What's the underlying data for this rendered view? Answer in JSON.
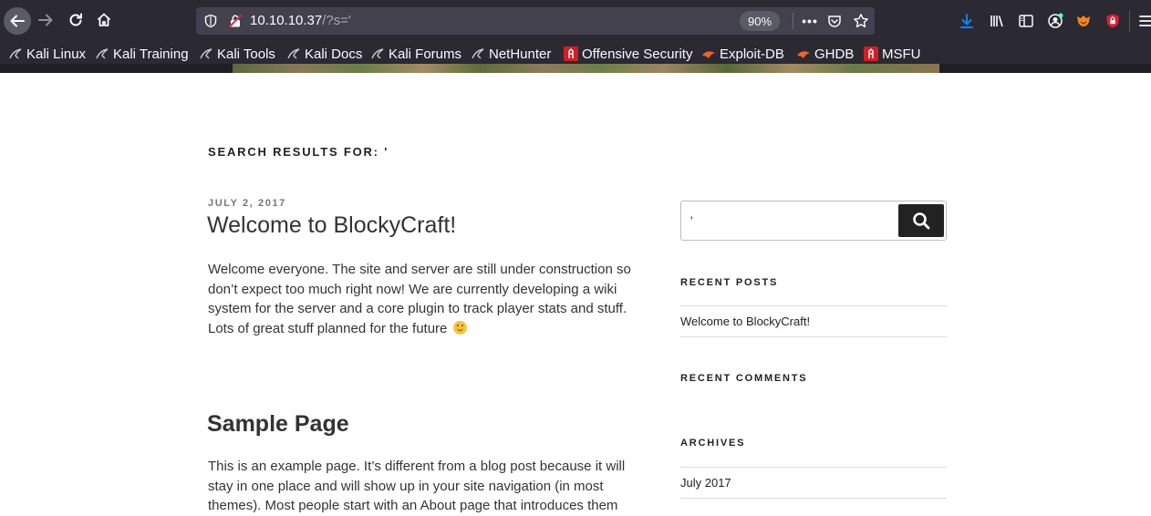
{
  "browser": {
    "url_host": "10.10.10.37",
    "url_path": "/?s='",
    "zoom": "90%",
    "bookmarks": [
      {
        "label": "Kali Linux",
        "icon": "kali-dragon-icon"
      },
      {
        "label": "Kali Training",
        "icon": "kali-dragon-icon"
      },
      {
        "label": "Kali Tools",
        "icon": "kali-dragon-icon"
      },
      {
        "label": "Kali Docs",
        "icon": "kali-dragon-icon"
      },
      {
        "label": "Kali Forums",
        "icon": "kali-dragon-icon"
      },
      {
        "label": "NetHunter",
        "icon": "kali-dragon-icon"
      },
      {
        "label": "Offensive Security",
        "icon": "offsec-icon"
      },
      {
        "label": "Exploit-DB",
        "icon": "exploitdb-icon"
      },
      {
        "label": "GHDB",
        "icon": "exploitdb-icon"
      },
      {
        "label": "MSFU",
        "icon": "offsec-icon"
      }
    ]
  },
  "content": {
    "search_heading": "Search Results for: '",
    "posts": [
      {
        "date": "July 2, 2017",
        "title": "Welcome to BlockyCraft!",
        "excerpt": "Welcome everyone. The site and server are still under construction so don’t expect too much right now! We are currently developing a wiki system for the server and a core plugin to track player stats and stuff. Lots of great stuff planned for the future"
      }
    ],
    "page": {
      "title": "Sample Page",
      "excerpt": "This is an example page. It’s different from a blog post because it will stay in one place and will show up in your site navigation (in most themes). Most people start with an About page that introduces them"
    }
  },
  "sidebar": {
    "search_value": "'",
    "recent_posts_title": "Recent Posts",
    "recent_posts": [
      "Welcome to BlockyCraft!"
    ],
    "recent_comments_title": "Recent Comments",
    "archives_title": "Archives",
    "archives": [
      "July 2017"
    ]
  }
}
